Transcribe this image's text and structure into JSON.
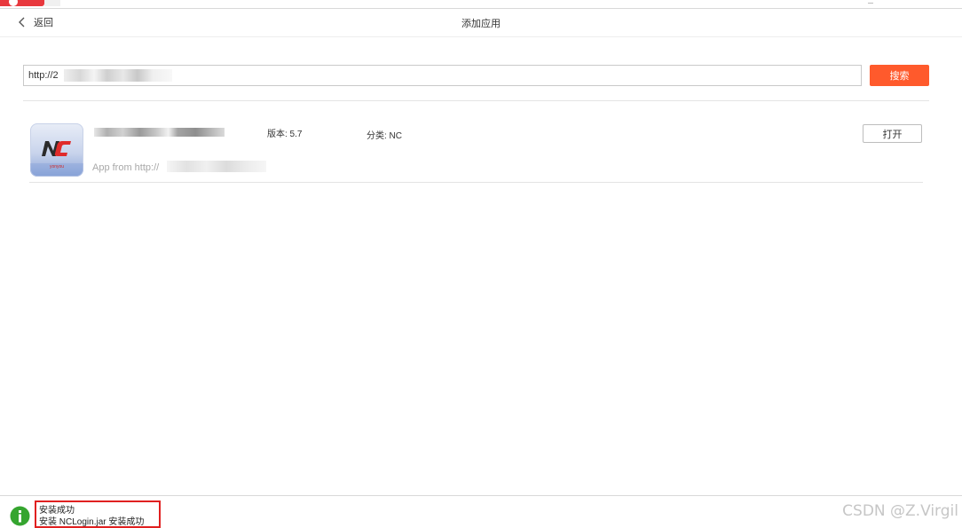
{
  "header": {
    "back_label": "返回",
    "title": "添加应用"
  },
  "search": {
    "value": "http://2",
    "button_label": "搜索"
  },
  "app": {
    "icon_text": "NC",
    "icon_brand": "yonyou",
    "version": "版本: 5.7",
    "category": "分类: NC",
    "source_prefix": "App from http://",
    "open_label": "打开"
  },
  "status": {
    "line1": "安装成功",
    "line2": "安装 NCLogin.jar 安装成功"
  },
  "watermark": "CSDN @Z.Virgil",
  "colors": {
    "accent": "#ff5a2c",
    "top_tab": "#e8383d",
    "highlight_border": "#e02020",
    "info_green": "#35a52f"
  },
  "icons": {
    "back": "chevron-left-icon",
    "info": "info-circle-icon"
  }
}
